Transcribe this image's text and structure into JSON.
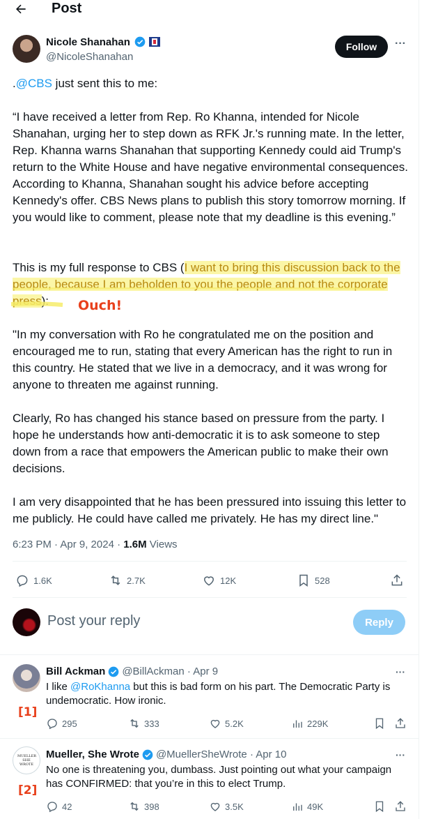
{
  "header": {
    "title": "Post"
  },
  "author": {
    "name": "Nicole Shanahan",
    "handle": "@NicoleShanahan",
    "follow_label": "Follow"
  },
  "tweet": {
    "p1_prefix": ".",
    "p1_mention": "@CBS",
    "p1_suffix": " just sent this to me:",
    "p2": "“I have received a letter from Rep. Ro Khanna, intended for Nicole Shanahan, urging her to step down as RFK Jr.'s running mate. In the letter, Rep. Khanna warns Shanahan that supporting Kennedy could aid Trump's return to the White House and have negative environmental consequences. According to Khanna, Shanahan sought his advice before accepting Kennedy's offer. CBS News plans to publish this story tomorrow morning. If you would like to comment, please note that my deadline is this evening.”",
    "p3_prefix": "This is my full response to CBS (",
    "p3_highlight": "I want to bring this discussion back to the people, because I am beholden to you the people and not the corporate press",
    "p3_suffix": "):",
    "annotation": "Ouch!",
    "p4": "\"In my conversation with Ro he congratulated me on the position and encouraged me to run, stating that every American has the right to run in this country. He stated that we live in a democracy, and it was wrong for anyone to threaten me against running.",
    "p5": "Clearly, Ro has changed his stance based on pressure from the party. I hope he understands how anti-democratic it is to ask someone to step down from a race that empowers the American public to make their own decisions.",
    "p6": "I am very disappointed that he has been pressured into issuing this letter to me publicly. He could have called me privately. He has my direct line.\"",
    "time": "6:23 PM · Apr 9, 2024 · ",
    "views_count": "1.6M",
    "views_label": " Views",
    "stats": {
      "replies": "1.6K",
      "reposts": "2.7K",
      "likes": "12K",
      "bookmarks": "528"
    }
  },
  "composer": {
    "placeholder": "Post your reply",
    "reply_label": "Reply"
  },
  "replies": [
    {
      "tag": "[1]",
      "name": "Bill Ackman",
      "meta": "@BillAckman · Apr 9",
      "text_prefix": "I like ",
      "mention": "@RoKhanna",
      "text_suffix": " but this is bad form on his part. The Democratic Party is undemocratic. How ironic.",
      "replies": "295",
      "reposts": "333",
      "likes": "5.2K",
      "views": "229K"
    },
    {
      "tag": "[2]",
      "name": "Mueller, She Wrote",
      "meta": "@MuellerSheWrote · Apr 10",
      "text": "No one is threatening you, dumbass. Just pointing out what your campaign has CONFIRMED: that you’re in this to elect Trump.",
      "avatar_text": "MUELLER SHE WROTE",
      "replies": "42",
      "reposts": "398",
      "likes": "3.5K",
      "views": "49K"
    }
  ],
  "colors": {
    "link": "#1d9bf0",
    "highlight": "#fbf6a7",
    "annotation": "#e8401c",
    "muted": "#536471"
  }
}
